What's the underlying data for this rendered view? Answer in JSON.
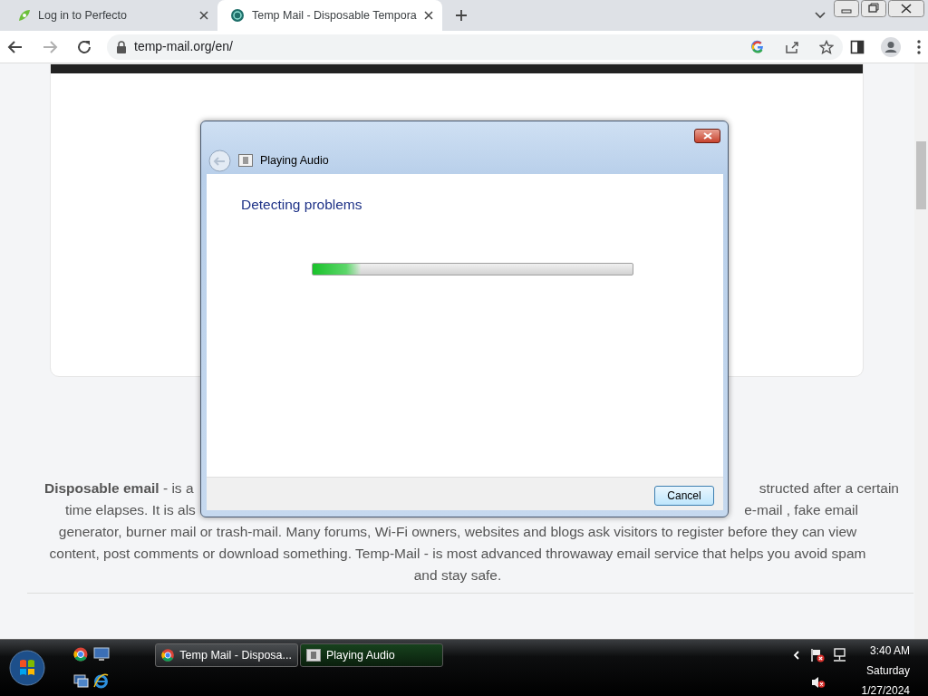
{
  "browser": {
    "tabs": [
      {
        "title": "Log in to Perfecto",
        "selected": false
      },
      {
        "title": "Temp Mail - Disposable Tempora",
        "selected": true
      }
    ],
    "address": "temp-mail.org/en/"
  },
  "page": {
    "lines": [
      {
        "left": "**Disposable email** - is a",
        "right": "structed after a certain"
      },
      {
        "left": "time elapses. It is als",
        "right": "e-mail , fake email"
      },
      {
        "text": "generator, burner mail or trash-mail. Many forums, Wi-Fi owners, websites and blogs ask visitors to register before they can view"
      },
      {
        "text": "content, post comments or download something. Temp-Mail - is most advanced throwaway email service that helps you avoid spam"
      },
      {
        "text": "and stay safe."
      }
    ]
  },
  "dialog": {
    "title": "Playing Audio",
    "heading": "Detecting problems",
    "progress": {
      "level": 0.15
    },
    "buttons": [
      "Cancel"
    ]
  },
  "taskbar": {
    "items": [
      {
        "label": "Temp Mail - Disposa...",
        "selected": false
      },
      {
        "label": "Playing Audio",
        "selected": true
      }
    ],
    "clock": {
      "time": "3:40 AM",
      "day": "Saturday",
      "date": "1/27/2024"
    }
  }
}
